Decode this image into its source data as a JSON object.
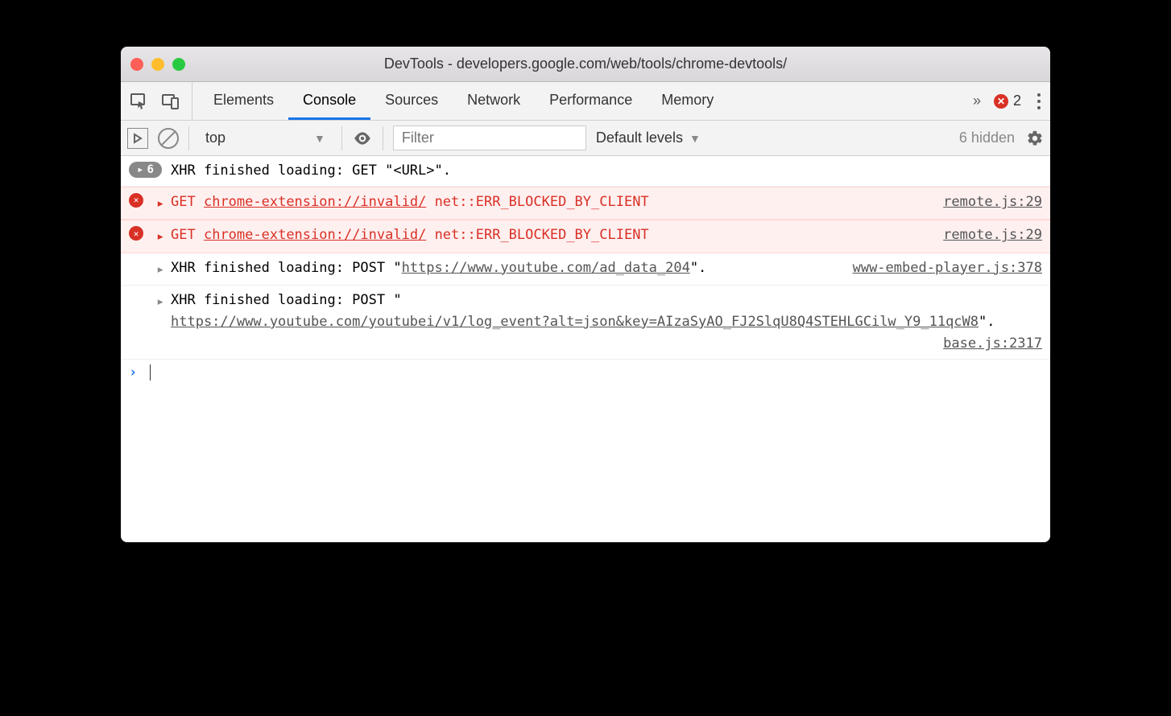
{
  "window": {
    "title": "DevTools - developers.google.com/web/tools/chrome-devtools/"
  },
  "tabbar": {
    "tabs": [
      "Elements",
      "Console",
      "Sources",
      "Network",
      "Performance",
      "Memory"
    ],
    "active_index": 1,
    "overflow_icon": "»",
    "error_count": "2"
  },
  "toolbar": {
    "context": "top",
    "filter_placeholder": "Filter",
    "levels_label": "Default levels",
    "hidden_label": "6 hidden"
  },
  "console": {
    "rows": [
      {
        "type": "info-grouped",
        "count": "6",
        "text": "XHR finished loading: GET \"<URL>\"."
      },
      {
        "type": "error",
        "method": "GET",
        "url": "chrome-extension://invalid/",
        "message": "net::ERR_BLOCKED_BY_CLIENT",
        "source": "remote.js:29"
      },
      {
        "type": "error",
        "method": "GET",
        "url": "chrome-extension://invalid/",
        "message": "net::ERR_BLOCKED_BY_CLIENT",
        "source": "remote.js:29"
      },
      {
        "type": "info",
        "prefix": "XHR finished loading: POST \"",
        "url": "https://www.youtube.com/ad_data_204",
        "suffix": "\".",
        "source": "www-embed-player.js:378"
      },
      {
        "type": "info",
        "prefix": "XHR finished loading: POST \"",
        "url": "https://www.youtube.com/youtubei/v1/log_event?alt=json&key=AIzaSyAO_FJ2SlqU8Q4STEHLGCilw_Y9_11qcW8",
        "suffix": "\".",
        "source": "base.js:2317"
      }
    ]
  }
}
